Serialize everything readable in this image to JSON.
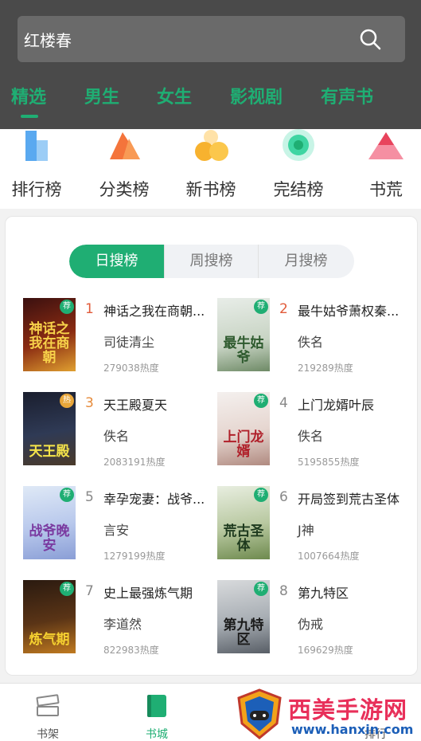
{
  "search": {
    "query": "红楼春"
  },
  "tabs": [
    "精选",
    "男生",
    "女生",
    "影视剧",
    "有声书"
  ],
  "categories": [
    "排行榜",
    "分类榜",
    "新书榜",
    "完结榜",
    "书荒"
  ],
  "rank_tabs": [
    "日搜榜",
    "周搜榜",
    "月搜榜"
  ],
  "books": [
    {
      "rank": "1",
      "title": "神话之我在商朝...",
      "author": "司徒清尘",
      "heat": "279038热度",
      "tag": "荐",
      "cover_text": "神话之我在商朝"
    },
    {
      "rank": "2",
      "title": "最牛姑爷萧权秦...",
      "author": "佚名",
      "heat": "219289热度",
      "tag": "荐",
      "cover_text": "最牛姑爷"
    },
    {
      "rank": "3",
      "title": "天王殿夏天",
      "author": "佚名",
      "heat": "2083191热度",
      "tag": "热",
      "cover_text": "天王殿"
    },
    {
      "rank": "4",
      "title": "上门龙婿叶辰",
      "author": "佚名",
      "heat": "5195855热度",
      "tag": "荐",
      "cover_text": "上门龙婿"
    },
    {
      "rank": "5",
      "title": "幸孕宠妻：战爷...",
      "author": "言安",
      "heat": "1279199热度",
      "tag": "荐",
      "cover_text": "战爷晚安"
    },
    {
      "rank": "6",
      "title": "开局签到荒古圣体",
      "author": "J神",
      "heat": "1007664热度",
      "tag": "荐",
      "cover_text": "荒古圣体"
    },
    {
      "rank": "7",
      "title": "史上最强炼气期",
      "author": "李道然",
      "heat": "822983热度",
      "tag": "荐",
      "cover_text": "炼气期"
    },
    {
      "rank": "8",
      "title": "第九特区",
      "author": "伪戒",
      "heat": "169629热度",
      "tag": "荐",
      "cover_text": "第九特区"
    }
  ],
  "bottom_nav": [
    "书架",
    "书城",
    "",
    "排行"
  ],
  "watermark": {
    "text": "西美手游网",
    "url": "www.hanxin.com"
  },
  "colors": {
    "accent": "#1fae73",
    "header_bg": "#4a4a4a",
    "rank_top": "#e15b3a"
  }
}
